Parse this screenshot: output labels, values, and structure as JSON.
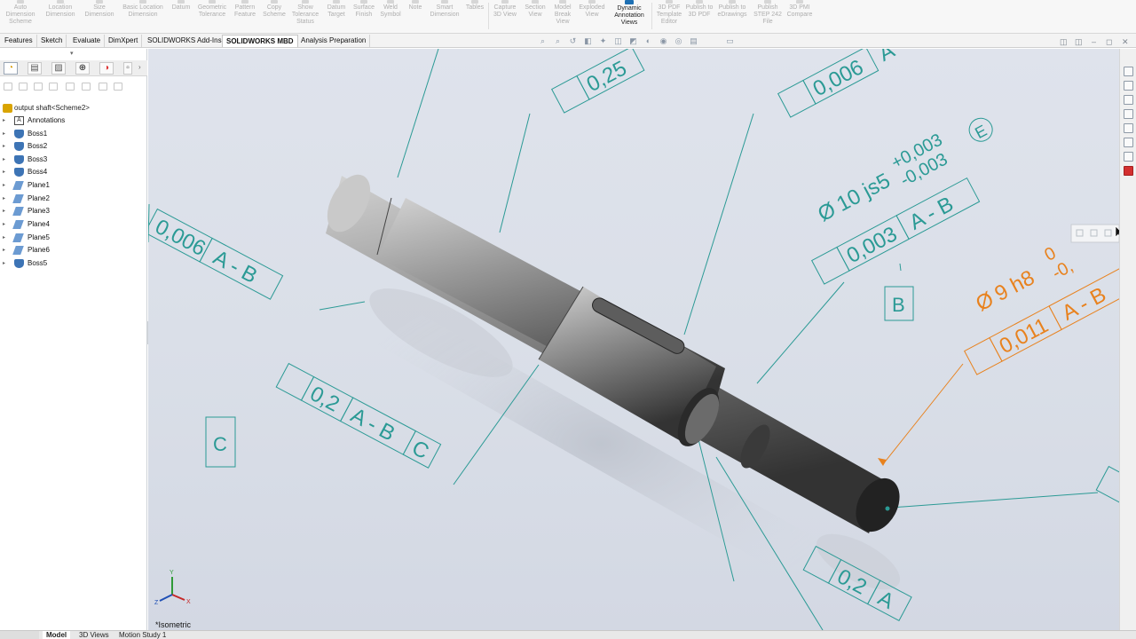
{
  "ribbon": {
    "buttons": [
      "Auto Dimension Scheme",
      "Location Dimension",
      "Size Dimension",
      "Basic Location Dimension",
      "Datum",
      "Geometric Tolerance",
      "Pattern Feature",
      "Copy Scheme",
      "Show Tolerance Status",
      "Datum Target",
      "Surface Finish",
      "Weld Symbol",
      "Note",
      "Smart Dimension",
      "Tables",
      "Capture 3D View",
      "Section View",
      "Model Break View",
      "Exploded View",
      "Dynamic Annotation Views",
      "3D PDF Template Editor",
      "Publish to 3D PDF",
      "Publish to eDrawings",
      "Publish STEP 242 File",
      "3D PMI Compare"
    ],
    "active_button": "Dynamic Annotation Views"
  },
  "tabs": [
    "Features",
    "Sketch",
    "Evaluate",
    "DimXpert",
    "SOLIDWORKS Add-Ins",
    "SOLIDWORKS MBD",
    "Analysis Preparation"
  ],
  "active_tab": "SOLIDWORKS MBD",
  "tree": {
    "root": "output shaft<Scheme2>",
    "items": [
      {
        "label": "Annotations",
        "icon": "annotations-icon"
      },
      {
        "label": "Boss1",
        "icon": "boss-feature-icon"
      },
      {
        "label": "Boss2",
        "icon": "boss-feature-icon"
      },
      {
        "label": "Boss3",
        "icon": "boss-feature-icon"
      },
      {
        "label": "Boss4",
        "icon": "boss-feature-icon"
      },
      {
        "label": "Plane1",
        "icon": "plane-icon"
      },
      {
        "label": "Plane2",
        "icon": "plane-icon"
      },
      {
        "label": "Plane3",
        "icon": "plane-icon"
      },
      {
        "label": "Plane4",
        "icon": "plane-icon"
      },
      {
        "label": "Plane5",
        "icon": "plane-icon"
      },
      {
        "label": "Plane6",
        "icon": "plane-icon"
      },
      {
        "label": "Boss5",
        "icon": "boss-feature-icon"
      }
    ]
  },
  "viewport": {
    "view_label": "*Isometric",
    "annotations": {
      "top_center_value": "0,25",
      "top_right_value": "0,006",
      "top_right_datum": "A",
      "diameter_sym": "Ø",
      "dim_10": "10 js5",
      "dim_10_upper": "+0,003",
      "dim_10_lower": "-0,003",
      "envelope": "E",
      "fcf_mid_value": "0,003",
      "fcf_mid_datum": "A - B",
      "datum_b": "B",
      "dim_9": "9 h8",
      "dim_9_tol": "-0,",
      "dim_9_partial": "0",
      "fcf_orange_value": "0,011",
      "fcf_orange_datum": "A - B",
      "fcf_left_value": "0,006",
      "fcf_left_datum": "A - B",
      "fcf_lower_value": "0,2",
      "fcf_lower_datum": "A - B",
      "fcf_lower_datum_c": "C",
      "datum_c": "C",
      "fcf_bottom_value": "0,2",
      "fcf_bottom_datum": "A"
    }
  },
  "bottom_tabs": [
    "Model",
    "3D Views",
    "Motion Study 1"
  ],
  "active_bottom_tab": "Model",
  "colors": {
    "annotation": "#2b9a95",
    "selected_annotation": "#e8821e",
    "accent": "#1d6fb3",
    "viewport_bg": "#dadfe8"
  }
}
